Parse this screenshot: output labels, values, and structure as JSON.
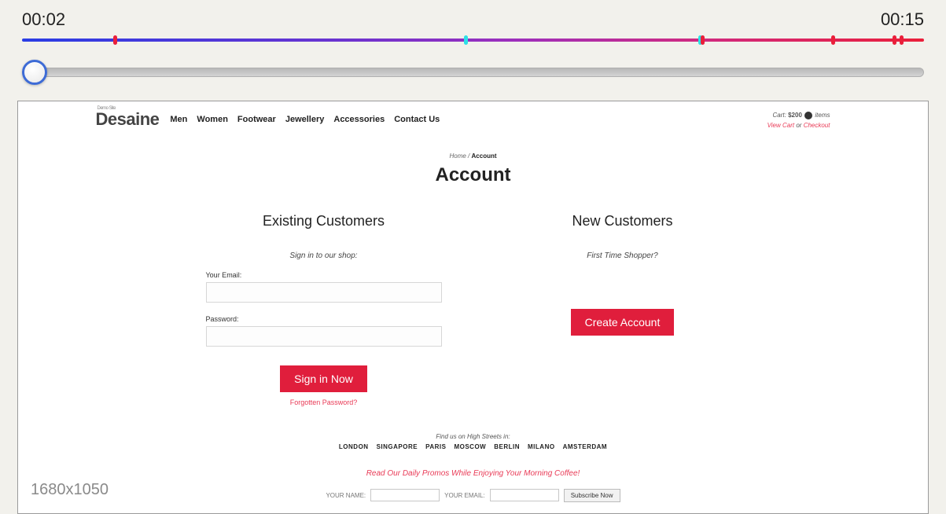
{
  "player": {
    "time_start": "00:02",
    "time_end": "00:15",
    "dimensions": "1680x1050",
    "markers": [
      {
        "pos": 10.1,
        "kind": "red"
      },
      {
        "pos": 49.0,
        "kind": "cyan"
      },
      {
        "pos": 75.0,
        "kind": "cyan"
      },
      {
        "pos": 75.2,
        "kind": "red"
      },
      {
        "pos": 89.7,
        "kind": "red"
      },
      {
        "pos": 96.5,
        "kind": "red"
      },
      {
        "pos": 97.3,
        "kind": "red"
      }
    ]
  },
  "site": {
    "logo_over": "Demo Site",
    "logo": "Desaine",
    "nav": [
      "Men",
      "Women",
      "Footwear",
      "Jewellery",
      "Accessories",
      "Contact Us"
    ],
    "cart": {
      "prefix": "Cart:",
      "amount": "$200",
      "items_suffix": "items",
      "view_cart": "View Cart",
      "or": "or",
      "checkout": "Checkout"
    },
    "breadcrumb_home": "Home",
    "breadcrumb_sep": "/",
    "breadcrumb_current": "Account",
    "page_title": "Account",
    "existing": {
      "heading": "Existing Customers",
      "subtitle": "Sign in to our shop:",
      "email_label": "Your Email:",
      "password_label": "Password:",
      "signin_btn": "Sign in Now",
      "forgot": "Forgotten Password?"
    },
    "newcust": {
      "heading": "New Customers",
      "subtitle": "First Time Shopper?",
      "create_btn": "Create Account"
    },
    "footer": {
      "find_us": "Find us on High Streets in:",
      "cities": [
        "LONDON",
        "SINGAPORE",
        "PARIS",
        "MOSCOW",
        "BERLIN",
        "MILANO",
        "AMSTERDAM"
      ],
      "promo": "Read Our Daily Promos While Enjoying Your Morning Coffee!",
      "your_name": "YOUR NAME:",
      "your_email": "YOUR EMAIL:",
      "subscribe": "Subscribe Now"
    }
  }
}
